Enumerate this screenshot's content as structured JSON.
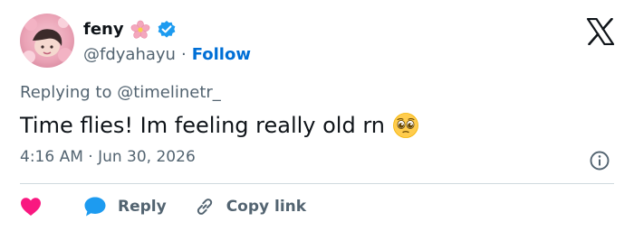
{
  "user": {
    "display_name": "feny",
    "handle": "@fdyahayu",
    "separator": "·",
    "follow_label": "Follow",
    "badge_icon": "flower-icon",
    "verified_icon": "verified-badge-icon"
  },
  "tweet": {
    "replying_to": "Replying to @timelinetr_",
    "text": "Time flies! Im feeling really old rn",
    "emoji": "pleading-face-emoji",
    "timestamp": "4:16 AM · Jun 30, 2026"
  },
  "actions": {
    "like_icon": "heart-icon",
    "reply_label": "Reply",
    "copy_link_label": "Copy link"
  },
  "colors": {
    "text": "#0f1419",
    "secondary": "#536471",
    "link": "#006fd6",
    "heart": "#f91880",
    "reply_bubble": "#1d9bf0",
    "verified": "#1d9bf0",
    "divider": "#cfd9de"
  }
}
